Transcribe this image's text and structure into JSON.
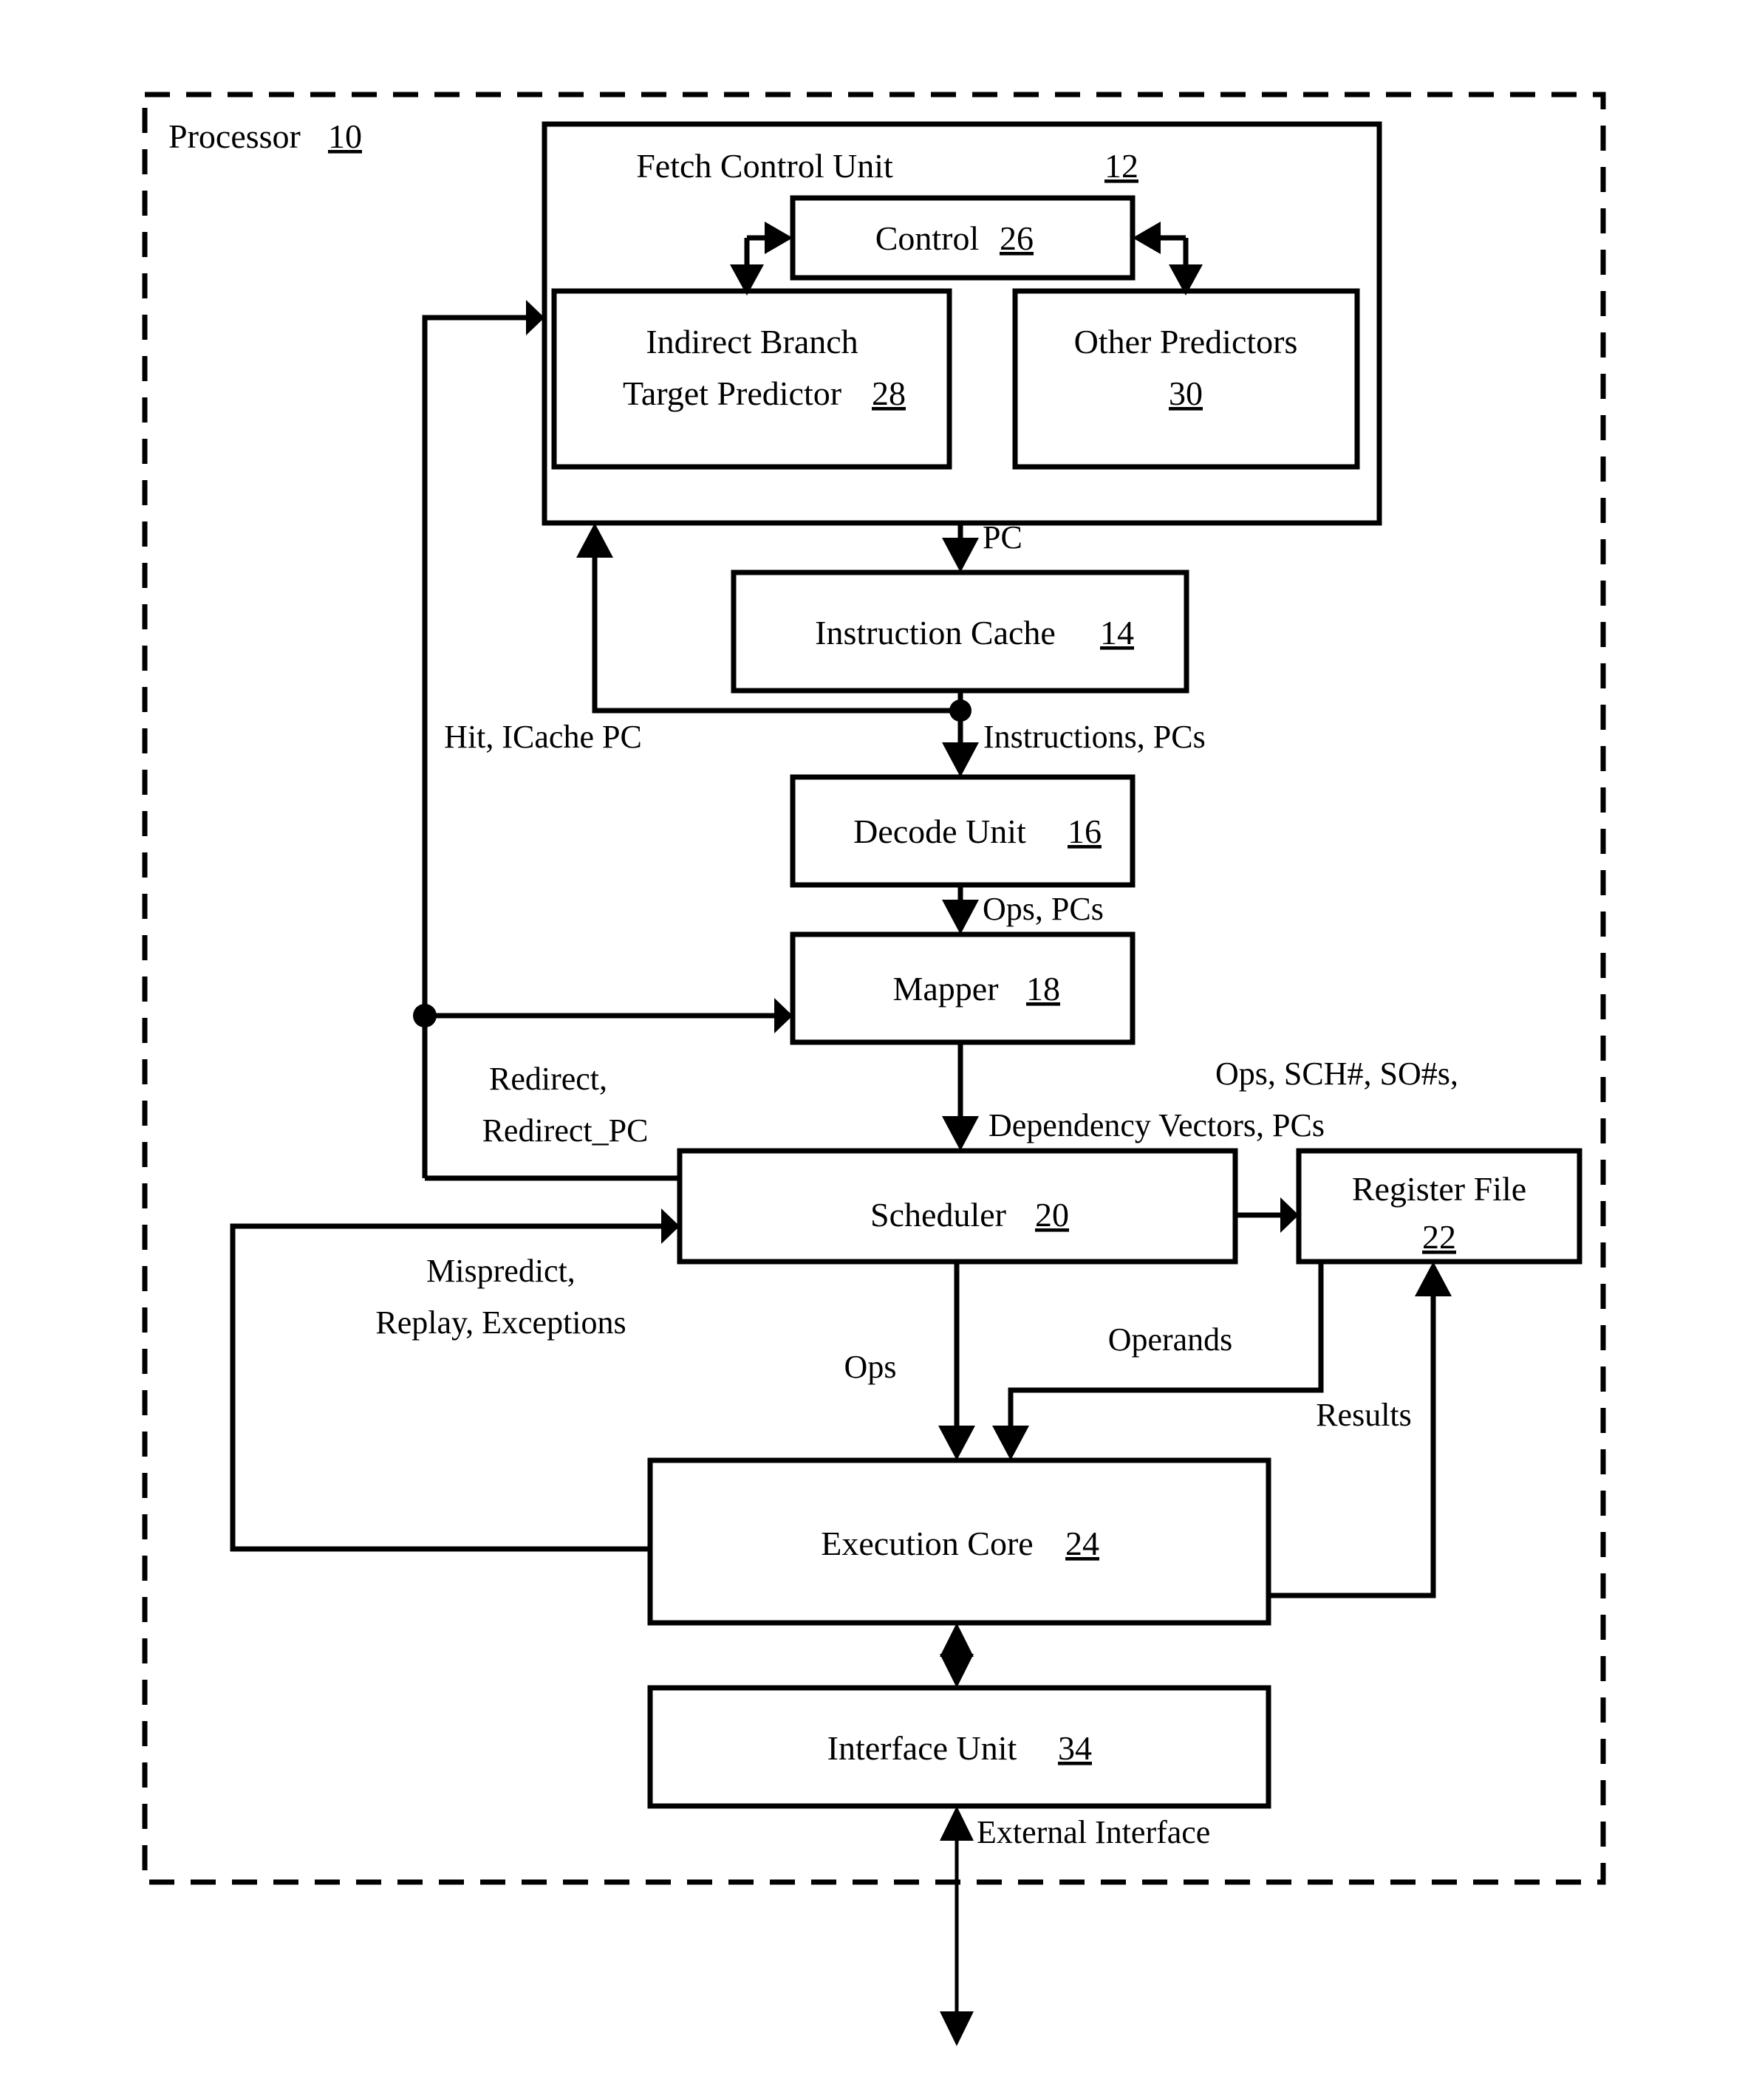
{
  "figure": {
    "outer_label": "Processor",
    "outer_ref": "10"
  },
  "blocks": {
    "fetch_control_unit": {
      "label": "Fetch Control Unit",
      "ref": "12"
    },
    "control": {
      "label": "Control",
      "ref": "26"
    },
    "indirect_branch_target_predictor": {
      "line1": "Indirect Branch",
      "line2": "Target Predictor",
      "ref": "28"
    },
    "other_predictors": {
      "line1": "Other Predictors",
      "ref": "30"
    },
    "instruction_cache": {
      "label": "Instruction Cache",
      "ref": "14"
    },
    "decode_unit": {
      "label": "Decode Unit",
      "ref": "16"
    },
    "mapper": {
      "label": "Mapper",
      "ref": "18"
    },
    "scheduler": {
      "label": "Scheduler",
      "ref": "20"
    },
    "register_file": {
      "line1": "Register File",
      "ref": "22"
    },
    "execution_core": {
      "label": "Execution Core",
      "ref": "24"
    },
    "interface_unit": {
      "label": "Interface Unit",
      "ref": "34"
    }
  },
  "signals": {
    "pc": "PC",
    "hit_icache_pc": "Hit, ICache PC",
    "instructions_pcs": "Instructions, PCs",
    "ops_pcs": "Ops, PCs",
    "redirect_line1": "Redirect,",
    "redirect_line2": "Redirect_PC",
    "ops_sch_line1": "Ops, SCH#, SO#s,",
    "ops_sch_line2": "Dependency Vectors, PCs",
    "mispredict_line1": "Mispredict,",
    "mispredict_line2": "Replay, Exceptions",
    "ops": "Ops",
    "operands": "Operands",
    "results": "Results",
    "external_interface": "External Interface"
  },
  "colors": {
    "ink": "#000000",
    "paper": "#ffffff"
  }
}
